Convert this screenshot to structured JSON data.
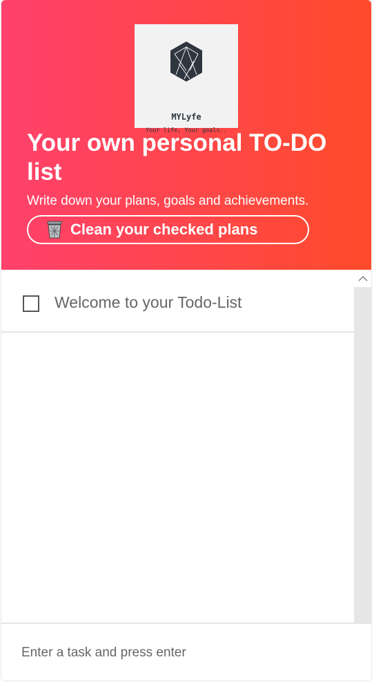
{
  "logo": {
    "name": "MYLyfe",
    "tagline": "Your life, Your goals.."
  },
  "header": {
    "title": "Your own personal TO-DO list",
    "subtitle": "Write down your plans, goals and achievements.",
    "clean_button_label": "Clean your checked plans",
    "clean_button_icon": "trash-can-icon"
  },
  "todos": [
    {
      "text": "Welcome to your Todo-List",
      "checked": false
    }
  ],
  "input": {
    "placeholder": "Enter a task and press enter",
    "value": ""
  },
  "colors": {
    "gradient_start": "#ff416c",
    "gradient_end": "#ff4b2b",
    "logo_dark": "#2f3640"
  }
}
